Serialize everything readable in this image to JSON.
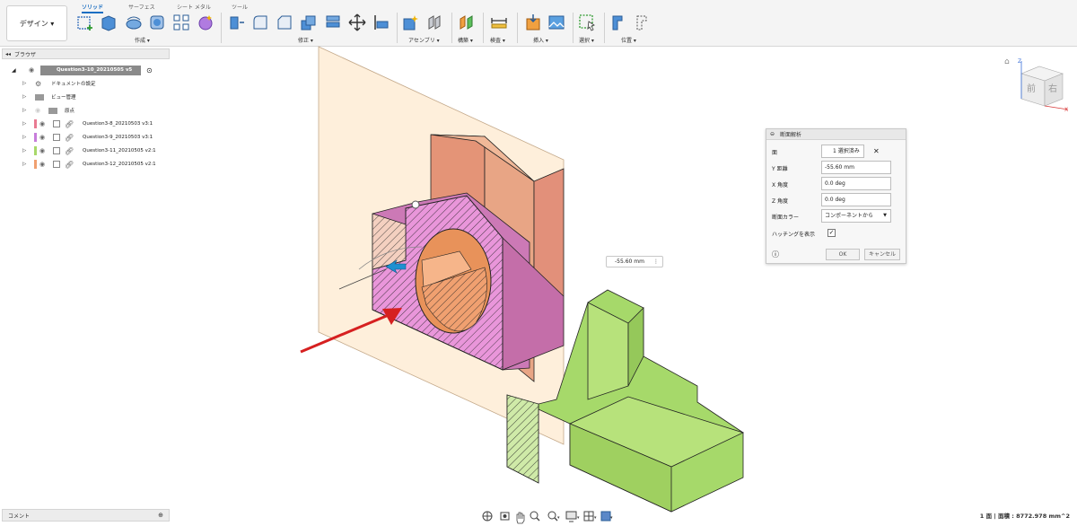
{
  "workspace": {
    "label": "デザイン ▾"
  },
  "tabs": [
    {
      "label": "ソリッド",
      "active": true
    },
    {
      "label": "サーフェス",
      "active": false
    },
    {
      "label": "シート メタル",
      "active": false
    },
    {
      "label": "ツール",
      "active": false
    }
  ],
  "toolbar_groups": [
    "作成 ▾",
    "修正 ▾",
    "アセンブリ ▾",
    "構築 ▾",
    "検査 ▾",
    "挿入 ▾",
    "選択 ▾",
    "位置 ▾"
  ],
  "browser": {
    "title": "ブラウザ",
    "root": "Question3-10_20210505 v5",
    "items": [
      {
        "label": "ドキュメントの設定",
        "color": ""
      },
      {
        "label": "ビュー管理",
        "color": ""
      },
      {
        "label": "原点",
        "color": ""
      },
      {
        "label": "Question3-8_20210503 v3:1",
        "color": "#e97a92"
      },
      {
        "label": "Question3-9_20210503 v3:1",
        "color": "#c77ddb"
      },
      {
        "label": "Question3-11_20210505 v2:1",
        "color": "#a8d86a"
      },
      {
        "label": "Question3-12_20210505 v2:1",
        "color": "#f0a070"
      }
    ]
  },
  "comments": {
    "label": "コメント"
  },
  "section_panel": {
    "title": "断面解析",
    "rows": [
      {
        "label": "面",
        "value": "1 選択済み"
      },
      {
        "label": "Y 距離",
        "value": "-55.60 mm"
      },
      {
        "label": "X 角度",
        "value": "0.0 deg"
      },
      {
        "label": "Z 角度",
        "value": "0.0 deg"
      },
      {
        "label": "断面カラー",
        "value": "コンポーネントから"
      },
      {
        "label": "ハッチングを表示",
        "value": ""
      }
    ],
    "hatching_checked": true,
    "ok_label": "OK",
    "cancel_label": "キャンセル"
  },
  "dimension_input": {
    "value": "-55.60 mm"
  },
  "view_cube": {
    "front": "前",
    "right": "右",
    "axis_z": "Z",
    "axis_x": "X"
  },
  "status": {
    "text": "1 面 | 面積 : 8772.978 mm^2"
  },
  "colors": {
    "accent": "#1b6ec2",
    "part_pink": "#d27ab6",
    "part_salmon": "#e89a7a",
    "part_green": "#a6d96a",
    "section_plane": "#fde9cf",
    "arrow": "#d62020"
  }
}
